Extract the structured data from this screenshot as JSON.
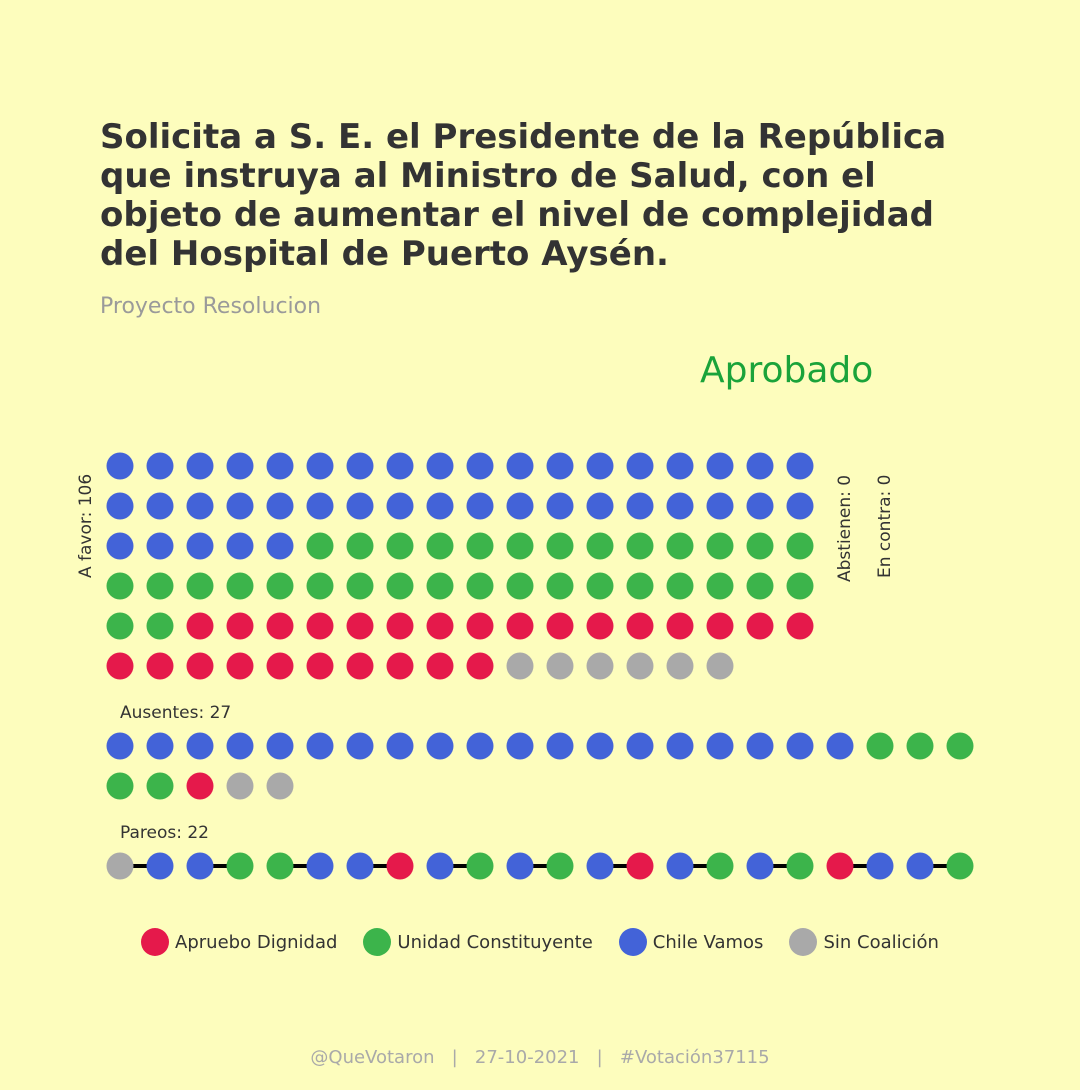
{
  "title": "Solicita a S. E. el Presidente de la República que instruya al Ministro de Salud, con el objeto de aumentar el nivel de complejidad del Hospital de Puerto Aysén.",
  "subtitle": "Proyecto Resolucion",
  "result": "Aprobado",
  "colors": {
    "background": "#fdfdbd",
    "Apruebo Dignidad": "#e5194b",
    "Unidad Constituyente": "#3cb44b",
    "Chile Vamos": "#4363d8",
    "Sin Coalición": "#a9a9a9",
    "result": "#1aa33a"
  },
  "chart_data": {
    "type": "dot-matrix",
    "groups": [
      {
        "key": "a_favor",
        "label": "A favor: 106",
        "count": 106,
        "breakdown": [
          {
            "coalition": "Chile Vamos",
            "count": 41
          },
          {
            "coalition": "Unidad Constituyente",
            "count": 33
          },
          {
            "coalition": "Apruebo Dignidad",
            "count": 26
          },
          {
            "coalition": "Sin Coalición",
            "count": 6
          }
        ]
      },
      {
        "key": "abstienen",
        "label": "Abstienen: 0",
        "count": 0,
        "breakdown": []
      },
      {
        "key": "en_contra",
        "label": "En contra: 0",
        "count": 0,
        "breakdown": []
      },
      {
        "key": "ausentes",
        "label": "Ausentes: 27",
        "count": 27,
        "breakdown": [
          {
            "coalition": "Chile Vamos",
            "count": 19
          },
          {
            "coalition": "Unidad Constituyente",
            "count": 5
          },
          {
            "coalition": "Apruebo Dignidad",
            "count": 1
          },
          {
            "coalition": "Sin Coalición",
            "count": 2
          }
        ]
      },
      {
        "key": "pareos",
        "label": "Pareos: 22",
        "count": 22,
        "pairs": [
          [
            "Sin Coalición",
            "Chile Vamos"
          ],
          [
            "Chile Vamos",
            "Unidad Constituyente"
          ],
          [
            "Unidad Constituyente",
            "Chile Vamos"
          ],
          [
            "Chile Vamos",
            "Apruebo Dignidad"
          ],
          [
            "Chile Vamos",
            "Unidad Constituyente"
          ],
          [
            "Chile Vamos",
            "Unidad Constituyente"
          ],
          [
            "Chile Vamos",
            "Apruebo Dignidad"
          ],
          [
            "Chile Vamos",
            "Unidad Constituyente"
          ],
          [
            "Chile Vamos",
            "Unidad Constituyente"
          ],
          [
            "Apruebo Dignidad",
            "Chile Vamos"
          ],
          [
            "Chile Vamos",
            "Unidad Constituyente"
          ]
        ]
      }
    ],
    "legend": [
      "Apruebo Dignidad",
      "Unidad Constituyente",
      "Chile Vamos",
      "Sin Coalición"
    ]
  },
  "footer": "@QueVotaron   |   27-10-2021   |   #Votación37115"
}
